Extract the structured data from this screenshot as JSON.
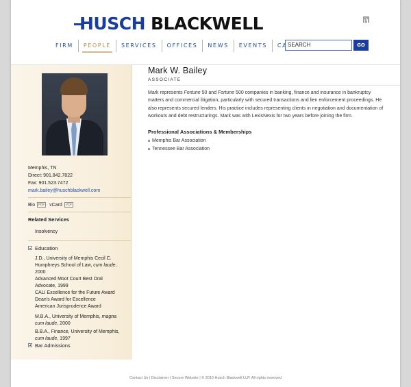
{
  "brand": {
    "logo_part1": "HUSCH",
    "logo_part2": "BLACKWELL"
  },
  "nav": {
    "items": [
      "FIRM",
      "PEOPLE",
      "SERVICES",
      "OFFICES",
      "NEWS",
      "EVENTS",
      "CAREERS"
    ],
    "active": "PEOPLE"
  },
  "search": {
    "value": "SEARCH",
    "button_label": "GO"
  },
  "profile": {
    "name": "Mark W. Bailey",
    "title": "ASSOCIATE",
    "bio_parts": {
      "p1": "Mark represents ",
      "em1": "Fortune",
      "p2": " 50 and ",
      "em2": "Fortune",
      "p3": " 500 companies in banking, finance and insurance in bankruptcy matters and commercial litigation, particularly with secured transactions and lien enforcement proceedings. He also represents secured lenders. His practice includes representing clients in negotiation and documentation of workouts and debt restructurings. Mark was with LexisNexis for two years before joining the firm."
    },
    "associations_heading": "Professional Associations & Memberships",
    "associations": [
      "Memphis Bar Association",
      "Tennessee Bar Association"
    ]
  },
  "sidebar": {
    "city": "Memphis, TN",
    "direct": "Direct: 901.842.7822",
    "fax": "Fax: 901.523.7472",
    "email": "mark.bailey@huschblackwell.com",
    "bio_label": "Bio",
    "pdf_badge": "PDF",
    "vcard_label": "vCard",
    "vcard_badge": "VCF",
    "related_heading": "Related Services",
    "related_items": [
      "Insolvency"
    ],
    "education_heading": "Education",
    "education": {
      "jd_line1": "J.D., University of Memphis Cecil C.",
      "jd_line2_plain": "Humphreys School of Law, ",
      "jd_line2_em": "cum laude",
      "jd_line2_end": ",",
      "jd_line3": "2000",
      "honor1a": "Advanced Moot Court Best Oral",
      "honor1b": "Advocate, 1999",
      "honor2": "CALI Excellence for the Future Award",
      "honor3": "Dean's Award for Excellence",
      "honor4": "American Jurisprudence Award",
      "mba_line1_plain": "M.B.A., University of Memphis, ",
      "mba_line1_em": "magna",
      "mba_line2_em": "cum laude",
      "mba_line2_end": ", 2000",
      "bba_line1": "B.B.A., Finance, University of Memphis,",
      "bba_line2_em": "cum laude",
      "bba_line2_end": ", 1997"
    },
    "bar_heading": "Bar Admissions"
  },
  "footer": "Contact Us  |  Disclaimer  |  Secure Website  |  © 2010 Husch Blackwell LLP. All rights reserved"
}
